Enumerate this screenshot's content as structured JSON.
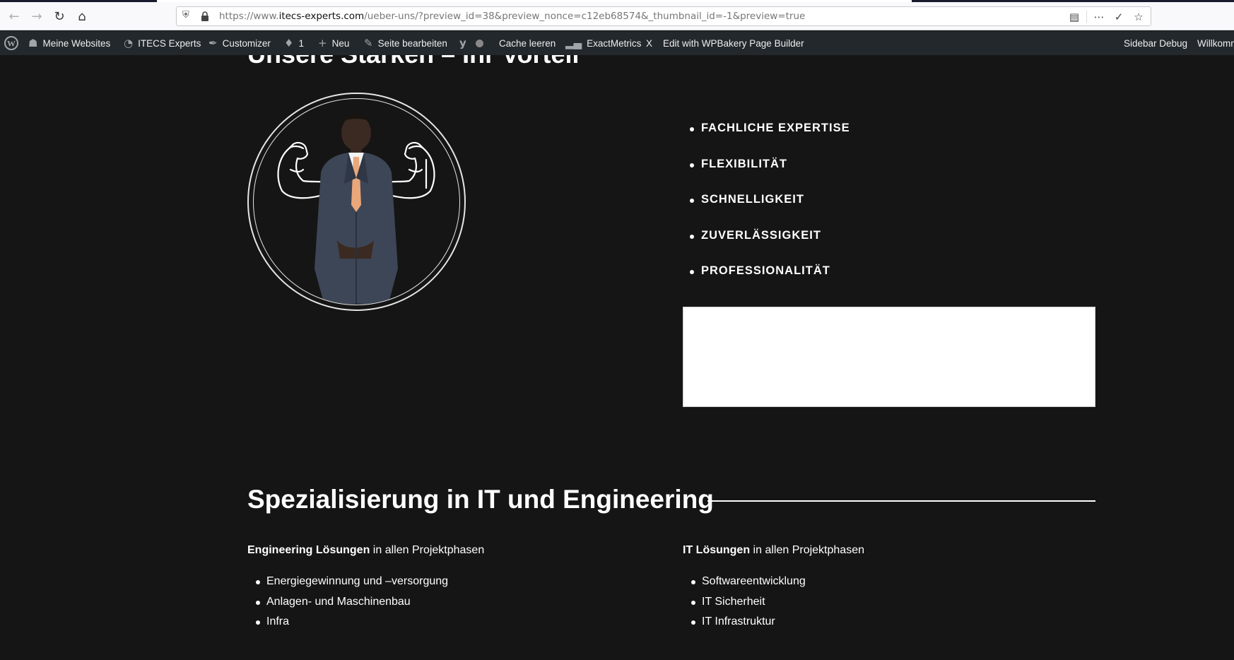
{
  "browser": {
    "url_prefix": "https://www.",
    "url_domain": "itecs-experts.com",
    "url_path": "/ueber-uns/?preview_id=38&preview_nonce=c12eb68574&_thumbnail_id=-1&preview=true",
    "nav_icons": [
      "back-icon",
      "forward-icon",
      "reload-icon",
      "home-icon"
    ],
    "url_right_icons": [
      "reader-view-icon",
      "more-icon",
      "pocket-icon",
      "bookmark-star-icon"
    ]
  },
  "adminbar": {
    "wp_logo": "wordpress-icon",
    "my_sites": "Meine Websites",
    "site_name": "ITECS Experts",
    "customizer": "Customizer",
    "comments_count": "1",
    "new": "Neu",
    "edit_page": "Seite bearbeiten",
    "clear_cache": "Cache leeren",
    "exactmetrics": "ExactMetrics",
    "x_label": "X",
    "wpbakery": "Edit with WPBakery Page Builder",
    "sidebar_debug": "Sidebar Debug",
    "welcome": "Willkommen"
  },
  "section_strengths": {
    "title": "Unsere Stärken – Ihr Vorteil",
    "items": [
      "FACHLICHE EXPERTISE",
      "FLEXIBILITÄT",
      "SCHNELLIGKEIT",
      "ZUVERLÄSSIGKEIT",
      "PROFESSIONALITÄT"
    ]
  },
  "section_specialization": {
    "title": "Spezialisierung in IT und Engineering",
    "engineering": {
      "intro_bold": "Engineering Lösungen",
      "intro_rest": " in allen Projektphasen",
      "items": [
        "Energiegewinnung und –versorgung",
        "Anlagen- und Maschinenbau",
        "Infra"
      ]
    },
    "it": {
      "intro_bold": "IT Lösungen",
      "intro_rest": " in allen Projektphasen",
      "items": [
        "Softwareentwicklung",
        "IT Sicherheit",
        "IT Infrastruktur"
      ]
    }
  },
  "colors": {
    "background": "#151515",
    "adminbar": "#23282d",
    "text": "#ffffff"
  }
}
